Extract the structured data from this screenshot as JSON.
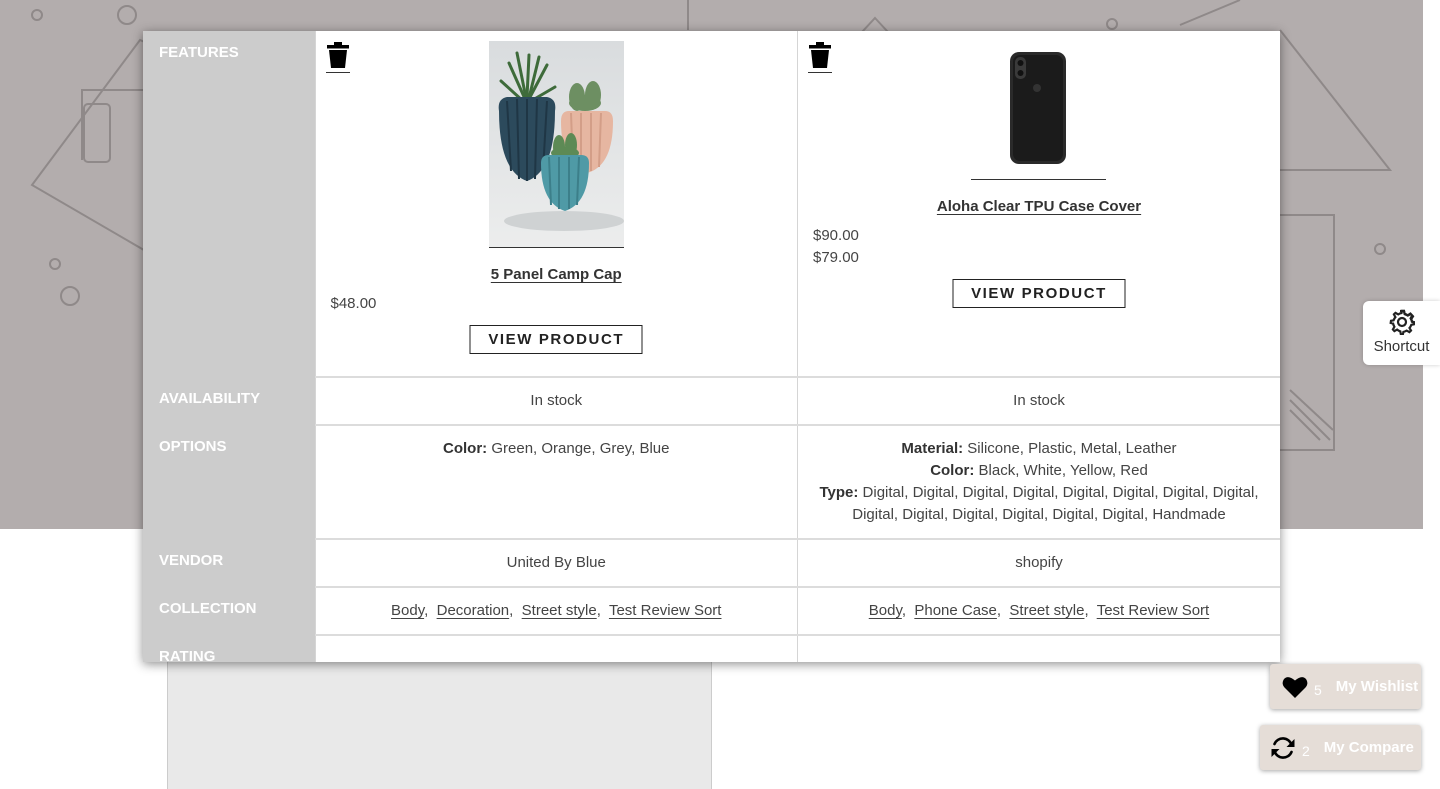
{
  "features_label": "FEATURES",
  "rows": {
    "availability": "AVAILABILITY",
    "options": "OPTIONS",
    "vendor": "VENDOR",
    "collection": "COLLECTION",
    "rating": "RATING"
  },
  "products": [
    {
      "name": "5 Panel Camp Cap",
      "prices": [
        "$48.00"
      ],
      "button": "VIEW PRODUCT",
      "availability": "In stock",
      "options": [
        {
          "label": "Color:",
          "value": "Green, Orange, Grey, Blue"
        }
      ],
      "vendor": "United By Blue",
      "collections": [
        "Body",
        "Decoration",
        "Street style",
        "Test Review Sort"
      ],
      "image": "potted-succulents-image"
    },
    {
      "name": "Aloha Clear TPU Case Cover",
      "prices": [
        "$90.00",
        "$79.00"
      ],
      "button": "VIEW PRODUCT",
      "availability": "In stock",
      "options": [
        {
          "label": "Material:",
          "value": "Silicone, Plastic, Metal, Leather"
        },
        {
          "label": "Color:",
          "value": "Black, White, Yellow, Red"
        },
        {
          "label": "Type:",
          "value": "Digital, Digital, Digital, Digital, Digital, Digital, Digital, Digital, Digital, Digital, Digital, Digital, Digital, Digital, Handmade"
        }
      ],
      "vendor": "shopify",
      "collections": [
        "Body",
        "Phone Case",
        "Street style",
        "Test Review Sort"
      ],
      "image": "black-phone-case-image"
    }
  ],
  "shortcut": {
    "label": "Shortcut",
    "icon": "gear-icon"
  },
  "wishlist": {
    "count": "5",
    "label": "My Wishlist",
    "icon": "heart-icon"
  },
  "compare": {
    "count": "2",
    "label": "My Compare",
    "icon": "refresh-icon"
  },
  "colors": {
    "feature_column": "#cccccc",
    "hero_bg": "#b3adad",
    "float_btn": "#e5ddd7"
  }
}
